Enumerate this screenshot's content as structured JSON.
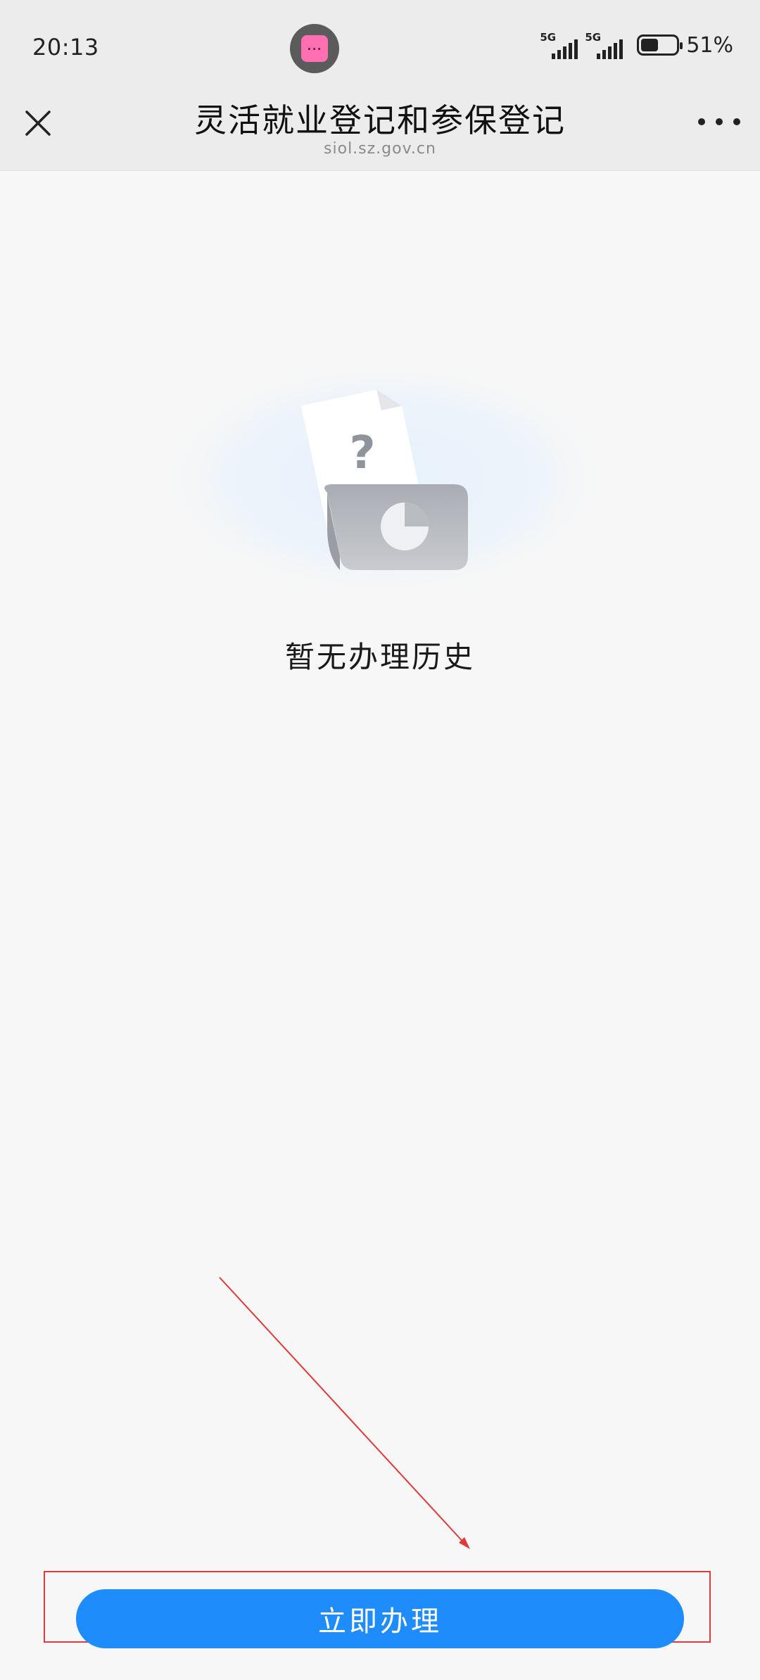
{
  "status_bar": {
    "time": "20:13",
    "center_app_icon": "pink-app-icon",
    "network_1_label": "5G",
    "network_2_label": "5G",
    "battery_percent": "51%",
    "battery_level": 0.51
  },
  "header": {
    "title": "灵活就业登记和参保登记",
    "url": "siol.sz.gov.cn",
    "close_icon": "close-icon",
    "more_icon": "more-dots-icon"
  },
  "empty_state": {
    "illustration_icon": "empty-document-icon",
    "message": "暂无办理历史"
  },
  "footer": {
    "apply_button_label": "立即办理"
  },
  "colors": {
    "primary_button": "#1e8cfa",
    "annotation": "#e03a3a",
    "background": "#f7f7f7",
    "header_bg": "#ececec"
  }
}
